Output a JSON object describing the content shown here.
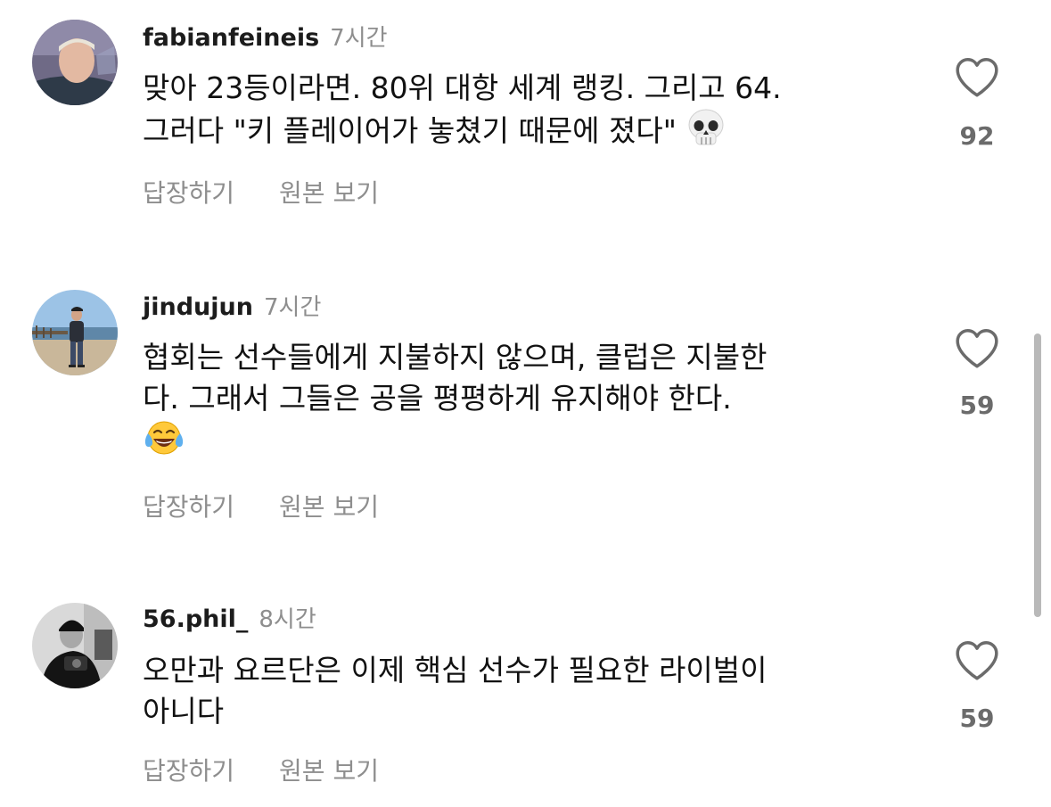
{
  "comments": [
    {
      "username": "fabianfeineis",
      "time": "7시간",
      "lines": [
        "맞아 23등이라면. 80위 대항 세계 랭킹. 그리고 64.",
        "그러다 \"키 플레이어가 놓쳤기 때문에 졌다\""
      ],
      "emoji": "skull-emoji",
      "likes": "92",
      "reply_label": "답장하기",
      "translate_label": "원본 보기"
    },
    {
      "username": "jindujun",
      "time": "7시간",
      "lines": [
        "협회는 선수들에게 지불하지 않으며, 클럽은 지불한",
        "다. 그래서 그들은 공을 평평하게 유지해야 한다."
      ],
      "emoji": "tears-of-joy-emoji",
      "likes": "59",
      "reply_label": "답장하기",
      "translate_label": "원본 보기"
    },
    {
      "username": "56.phil_",
      "time": "8시간",
      "lines": [
        "오만과 요르단은 이제 핵심 선수가 필요한 라이벌이",
        "아니다"
      ],
      "emoji": "",
      "likes": "59",
      "reply_label": "답장하기",
      "translate_label": "원본 보기"
    }
  ],
  "icons": {
    "like": "heart-outline-icon"
  },
  "colors": {
    "username": "#1c1c1c",
    "secondary": "#8e8e8e",
    "like_count": "#6b6b6b",
    "scrollbar": "#b9b9b9"
  }
}
